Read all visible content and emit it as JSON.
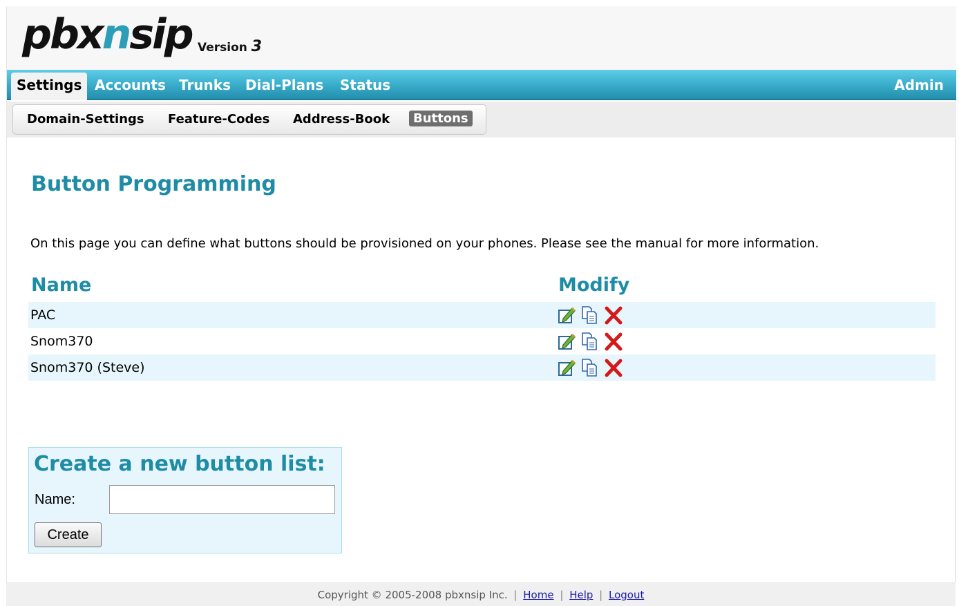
{
  "header": {
    "logo": {
      "part1": "pbx",
      "part2": "n",
      "part3": "sip"
    },
    "version_label": "Version",
    "version_number": "3"
  },
  "mainnav": {
    "tabs": [
      {
        "label": "Settings",
        "active": true
      },
      {
        "label": "Accounts",
        "active": false
      },
      {
        "label": "Trunks",
        "active": false
      },
      {
        "label": "Dial-Plans",
        "active": false
      },
      {
        "label": "Status",
        "active": false
      }
    ],
    "admin_label": "Admin"
  },
  "subnav": {
    "tabs": [
      {
        "label": "Domain-Settings",
        "active": false
      },
      {
        "label": "Feature-Codes",
        "active": false
      },
      {
        "label": "Address-Book",
        "active": false
      },
      {
        "label": "Buttons",
        "active": true
      }
    ]
  },
  "main": {
    "title": "Button Programming",
    "intro": "On this page you can define what buttons should be provisioned on your phones. Please see the manual for more information.",
    "columns": {
      "name": "Name",
      "modify": "Modify"
    },
    "rows": [
      {
        "name": "PAC",
        "icons": [
          "edit-icon",
          "copy-icon",
          "delete-icon"
        ]
      },
      {
        "name": "Snom370",
        "icons": [
          "edit-icon",
          "copy-icon",
          "delete-icon"
        ]
      },
      {
        "name": "Snom370 (Steve)",
        "icons": [
          "edit-icon",
          "copy-icon",
          "delete-icon"
        ]
      }
    ]
  },
  "create": {
    "title": "Create a new button list:",
    "name_label": "Name:",
    "name_value": "",
    "button_label": "Create"
  },
  "footer": {
    "copyright": "Copyright © 2005-2008 pbxnsip Inc.",
    "links": [
      "Home",
      "Help",
      "Logout"
    ],
    "separator": "|"
  },
  "colors": {
    "accent": "#1f8ca6",
    "nav_gradient_top": "#5fcde6",
    "nav_gradient_bottom": "#238fad",
    "row_alt": "#e6f6fc",
    "delete_red": "#d21a1a"
  }
}
